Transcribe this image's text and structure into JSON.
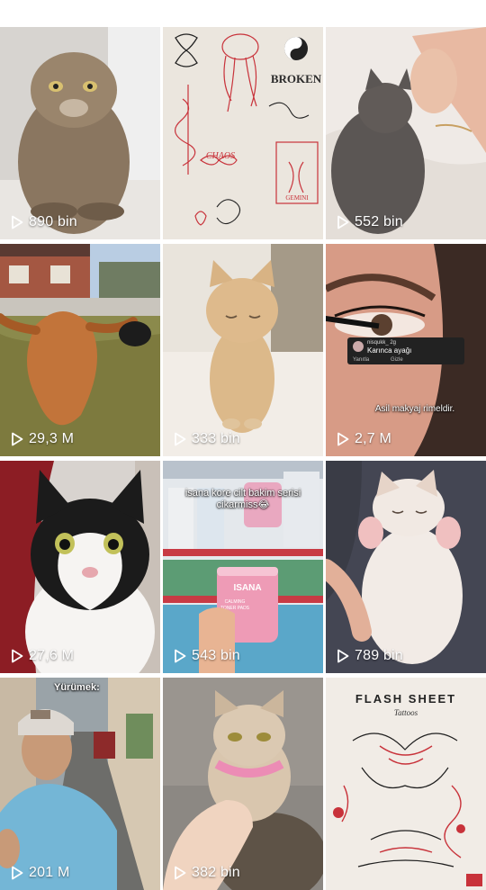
{
  "tiles": [
    {
      "views": "890 bin",
      "subject": "manul-cat",
      "bg": [
        "#7d6a55",
        "#c9bba6"
      ]
    },
    {
      "views": "",
      "subject": "tattoo-flash-sheet",
      "bg": [
        "#ece7df",
        "#d9cfc3"
      ],
      "text": {
        "broken": "BROKEN",
        "chaos": "CHAOS",
        "gemini": "GEMINI"
      }
    },
    {
      "views": "552 bin",
      "subject": "grey-kitten-hand",
      "bg": [
        "#5a5552",
        "#eeeae6"
      ]
    },
    {
      "views": "29,3 M",
      "subject": "orange-cat-yard",
      "bg": [
        "#b77a3a",
        "#6f8a46"
      ]
    },
    {
      "views": "333 bin",
      "subject": "orange-cat-standing",
      "bg": [
        "#d9c7a8",
        "#efe6d6"
      ]
    },
    {
      "views": "2,7 M",
      "subject": "mascara-closeup",
      "bg": [
        "#d39a87",
        "#3b2a24"
      ],
      "comment": {
        "user": "nisqukk_ 2g",
        "text": "Karınca ayağı",
        "reply": "Yanıtla",
        "hide": "Gizle"
      },
      "caption": "Asil makyaj rimeldir."
    },
    {
      "views": "27,6 M",
      "subject": "black-white-cat",
      "bg": [
        "#8e1d23",
        "#f3f1ef"
      ]
    },
    {
      "views": "543 bin",
      "subject": "skincare-shelf",
      "bg": [
        "#c9d2da",
        "#e9a6bd"
      ],
      "caption": "isana kore cilt bakim serisi cikarmiss😂",
      "product": {
        "brand": "ISANA",
        "line1": "CALMING",
        "line2": "TONER PADS"
      }
    },
    {
      "views": "789 bin",
      "subject": "kitten-sleeping",
      "bg": [
        "#efe6df",
        "#3a3a42"
      ]
    },
    {
      "views": "201 M",
      "subject": "boy-street",
      "bg": [
        "#6fb4d6",
        "#7c7c78"
      ],
      "caption": "Yürümek:"
    },
    {
      "views": "382 bin",
      "subject": "cat-pink-harness",
      "bg": [
        "#8a8580",
        "#d8c6b0"
      ]
    },
    {
      "views": "",
      "subject": "flash-sheet-tattoos",
      "bg": [
        "#f1ece6",
        "#e3d7cc"
      ],
      "text": {
        "title": "FLASH SHEET",
        "subtitle": "Tattoos"
      }
    }
  ],
  "icons": {
    "play": "play-outline-icon"
  },
  "colors": {
    "overlay_text": "#ffffff",
    "tattoo_red": "#c8323a",
    "background": "#ffffff"
  }
}
